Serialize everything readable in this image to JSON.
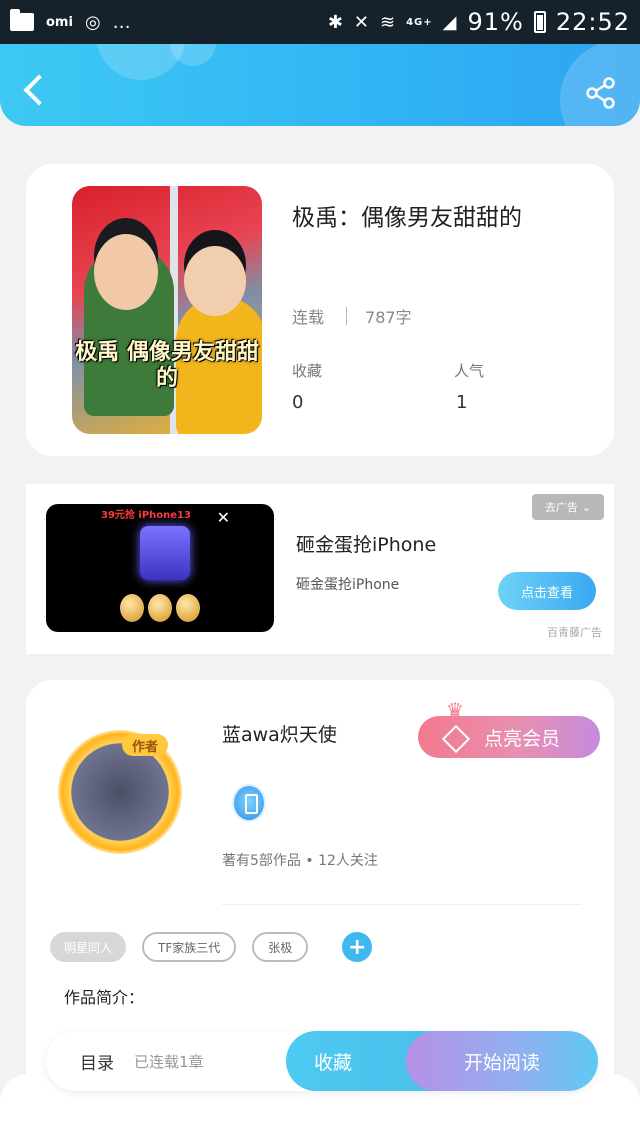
{
  "status_bar": {
    "carrier": "omi",
    "battery": "91%",
    "time": "22:52",
    "network": "4G+"
  },
  "header": {
    "back_icon": "chevron-left-icon",
    "share_icon": "share-icon"
  },
  "book": {
    "cover_caption": "极禹 偶像男友甜甜的",
    "title": "极禹：偶像男友甜甜的",
    "status": "连载",
    "word_count": "787字",
    "favorites_label": "收藏",
    "favorites_value": "0",
    "popularity_label": "人气",
    "popularity_value": "1"
  },
  "ad": {
    "banner_text": "39元抢 iPhone13",
    "title": "砸金蛋抢iPhone",
    "subtitle": "砸金蛋抢iPhone",
    "remove_label": "去广告",
    "cta_label": "点击查看",
    "source": "百青藤广告"
  },
  "author": {
    "badge": "作者",
    "name": "蓝awa炽天使",
    "stats": "著有5部作品 • 12人关注",
    "vip_label": "点亮会员"
  },
  "tags": [
    "明星同人",
    "TF家族三代",
    "张极"
  ],
  "intro_label": "作品简介：",
  "bottom_bar": {
    "toc_label": "目录",
    "chapter_count": "已连载1章",
    "favorite_label": "收藏",
    "read_label": "开始阅读"
  },
  "colors": {
    "accent_blue": "#31b4f4",
    "vip_pink": "#f47a8c"
  }
}
